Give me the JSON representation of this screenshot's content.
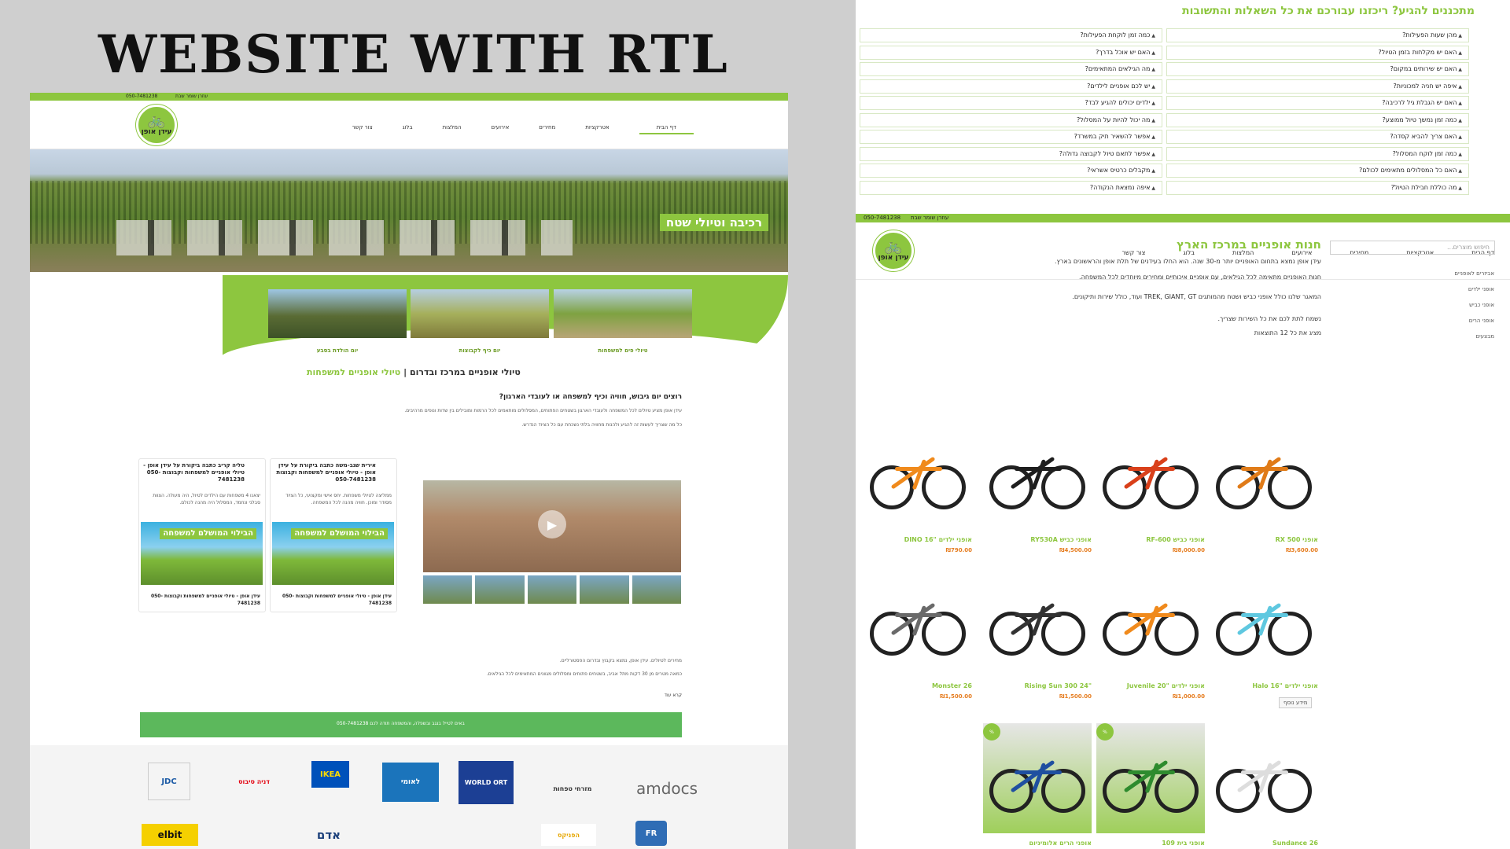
{
  "showcase": {
    "title": "WEBSITE WITH RTL"
  },
  "left_site": {
    "topbar": {
      "phone": "050-7481238",
      "hours": "עוזרן שומר שבת"
    },
    "logo": {
      "name": "עידן אופן"
    },
    "nav": [
      "דף הבית",
      "אטרקציות",
      "מחירים",
      "אירועים",
      "המלצות",
      "בלוג",
      "צור קשר"
    ],
    "hero_caption": "רכיבה וטיולי שטח",
    "thumbs": [
      {
        "caption": "טיולי פים למשפחות"
      },
      {
        "caption": "יום כיף לקבוצות"
      },
      {
        "caption": "יום הולדת בסבע"
      }
    ],
    "section_title": "טיולי אופניים במרכז ובדרום",
    "section_title_sep": "|",
    "section_title_accent": "טיולי אופניים למשפחות",
    "question": "רוצים יום גיבוש, חוויה וכיף למשפחה או לעובדי הארגון?",
    "para1": "עידן אופן מציע טיולים לכל המשפחה ולעובדי הארגון בשטחים הפתוחים, המסלולים מותאמים לכל הרמות ומובילים בין שדות ונופים מרהיבים.",
    "para2": "כל מה שצריך לעשות זה להגיע ולהנות מחוויה בלתי נשכחת עם כל הציוד הנדרש.",
    "fb_cards": [
      {
        "header": "אירית שגב-משה כתבה ביקורת על עידן אופן - טיולי אופניים למשפחות וקבוצות 050-7481238",
        "body": "ממליצה לטיולי משפחות. יחס אישי ומקצועי, כל הציוד מסודר ומוכן. חוויה מהנה לכל המשפחה.",
        "banner": "הבילוי המושלם למשפחה",
        "footer": "עידן אופן - טיולי אופניים למשפחות וקבוצות 050-7481238"
      },
      {
        "header": "טליה קריב כתבה ביקורת על עידן אופן - טיולי אופניים למשפחות וקבוצות 050-7481238",
        "body": "יצאנו 4 משפחות עם הילדים לטיול, היה מעולה. הצוות סבלני ונחמד, המסלול היה מהנה לכולם.",
        "banner": "הבילוי המושלם למשפחה",
        "footer": "עידן אופן - טיולי אופניים למשפחות וקבוצות 050-7481238"
      }
    ],
    "bottom_para1": "מחירים לטיולים. עידן אופן, נמצא בקבוץ ובדרום הפסטורליים.",
    "bottom_para2": "כמאה מטרים מן 30 דקות מתל אביב, בשטחים פתוחים ומסלולים מגוונים המתאימים לכל הגילאים.",
    "read_more": "קרא עוד",
    "green_strip": "באים לטייל בנגב ובשפלה, והמשפחה תודה לכם 050-7481238",
    "partners": [
      "amdocs",
      "מזרחי טפחות",
      "WORLD ORT",
      "לאומי",
      "IKEA",
      "דניה סיבוס",
      "JDC",
      "elbit",
      "אדם",
      "הפניקס",
      "FR"
    ]
  },
  "faq": {
    "title": "מתכננים להגיע? ריכזנו עבורכם את כל השאלות והתשובות",
    "right_col": [
      "מהן שעות הפעילות?",
      "האם יש מקלחות בזמן הטיול?",
      "האם יש שירותים במקום?",
      "איפה יש חניה למכוניות?",
      "האם יש הגבלת גיל לרכיבה?",
      "כמה זמן נמשך טיול ממוצע?",
      "האם צריך להביא קסדה?",
      "כמה זמן לוקח המסלול?",
      "האם כל המסלולים מתאימים לכולם?",
      "מה כוללת חבילת הטיול?"
    ],
    "left_col": [
      "כמה זמן לוקחת הפעילות?",
      "האם יש אוכל בדרך?",
      "מה הגילאים המתאימים?",
      "יש לכם אופניים לילדים?",
      "ילדים יכולים להגיע לבד?",
      "מה יכול להיות על המסלול?",
      "אפשר להשאיר תיק במשרד?",
      "אפשר לתאם טיול לקבוצה גדולה?",
      "מקבלים כרטיס אשראי?",
      "איפה נמצאת הנקודה?"
    ]
  },
  "shop": {
    "topbar": {
      "phone": "050-7481238",
      "hours": "עוזרן שומר שבת"
    },
    "nav": [
      "דף הבית",
      "אטרקציות",
      "מחירים",
      "אירועים",
      "המלצות",
      "בלוג",
      "צור קשר"
    ],
    "title": "חנות אופניים במרכז הארץ",
    "intro": [
      "עידן אופן נמצא בתחום האופניים יותר מ-30 שנה. הוא החלו בעידנים של תלת אופן והראשונים בארץ.",
      "חנות האופניים מתאימה לכל הגילאים, עם אופניים איכותיים ומחירים מיוחדים לכל המשפחה.",
      "המאגר שלנו כולל אופני כביש ושטח מהמותגים TREK, GIANT, GT ועוד, כולל שירות ותיקונים.",
      "נשמח לתת לכם את כל השירות שצריך.",
      "מציג את כל 12 התוצאות"
    ],
    "search_placeholder": "חיפוש מוצרים...",
    "categories": [
      "אביזרים לאופניים",
      "אופני ילדים",
      "אופני כביש",
      "אופני הרים",
      "מבצעים"
    ],
    "products": [
      {
        "name": "אופני 500 RX",
        "price": "₪3,600.00"
      },
      {
        "name": "אופני כביש RF-600",
        "price": "₪8,000.00"
      },
      {
        "name": "אופני כביש RY530A",
        "price": "₪4,500.00"
      },
      {
        "name": "אופני ילדים \"16 DINO",
        "price": "₪790.00"
      },
      {
        "name": "אופני ילדים \"16 Halo",
        "price": ""
      },
      {
        "name": "אופני ילדים \"20 Juvenile",
        "price": "₪1,000.00"
      },
      {
        "name": "\"Rising Sun 300 24",
        "price": "₪1,500.00"
      },
      {
        "name": "Monster 26",
        "price": "₪1,500.00"
      },
      {
        "name": "Sundance 26",
        "price": ""
      },
      {
        "name": "אופני בית 109",
        "price": ""
      },
      {
        "name": "אופני הרים אלומיניום",
        "price": ""
      }
    ],
    "more_info": "מידע נוסף",
    "shop_sign_phone": "050 7481238"
  }
}
